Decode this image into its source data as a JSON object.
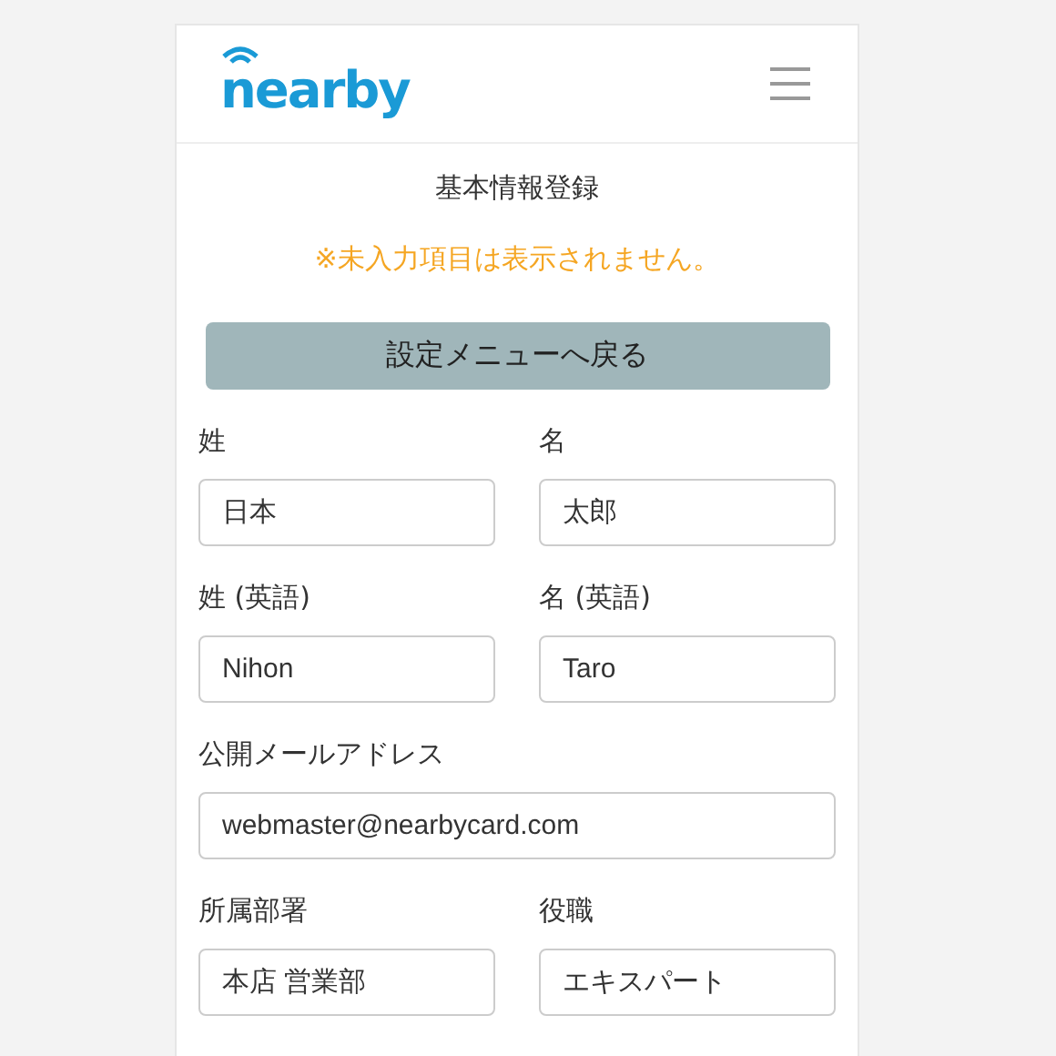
{
  "header": {
    "logo": "nearby"
  },
  "title": "基本情報登録",
  "notice": "※未入力項目は表示されません。",
  "back_button": "設定メニューへ戻る",
  "fields": [
    {
      "label": "姓",
      "value": "日本",
      "kind": "half"
    },
    {
      "label": "名",
      "value": "太郎",
      "kind": "half"
    },
    {
      "label": "姓 (英語)",
      "value": "Nihon",
      "kind": "half"
    },
    {
      "label": "名 (英語)",
      "value": "Taro",
      "kind": "half"
    },
    {
      "label": "公開メールアドレス",
      "value": "webmaster@nearbycard.com",
      "kind": "full"
    },
    {
      "label": "所属部署",
      "value": "本店 営業部",
      "kind": "half"
    },
    {
      "label": "役職",
      "value": "エキスパート",
      "kind": "half"
    }
  ]
}
